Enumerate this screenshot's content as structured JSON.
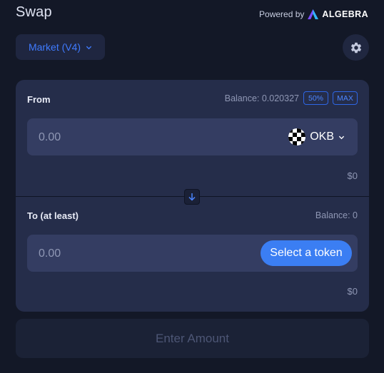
{
  "header": {
    "title": "Swap",
    "powered_by": "Powered by",
    "brand_name": "ALGEBRA"
  },
  "toolbar": {
    "market_label": "Market (V4)"
  },
  "from": {
    "label": "From",
    "balance_text": "Balance: 0.020327",
    "half_label": "50%",
    "max_label": "MAX",
    "amount_placeholder": "0.00",
    "token_symbol": "OKB",
    "usd_value": "$0"
  },
  "to": {
    "label": "To (at least)",
    "balance_text": "Balance: 0",
    "amount_placeholder": "0.00",
    "select_token_label": "Select a token",
    "usd_value": "$0"
  },
  "action": {
    "label": "Enter Amount"
  },
  "colors": {
    "background": "#131827",
    "card": "#252d4a",
    "input": "#343d62",
    "accent": "#3b7ef3",
    "muted": "#8f97b4"
  }
}
